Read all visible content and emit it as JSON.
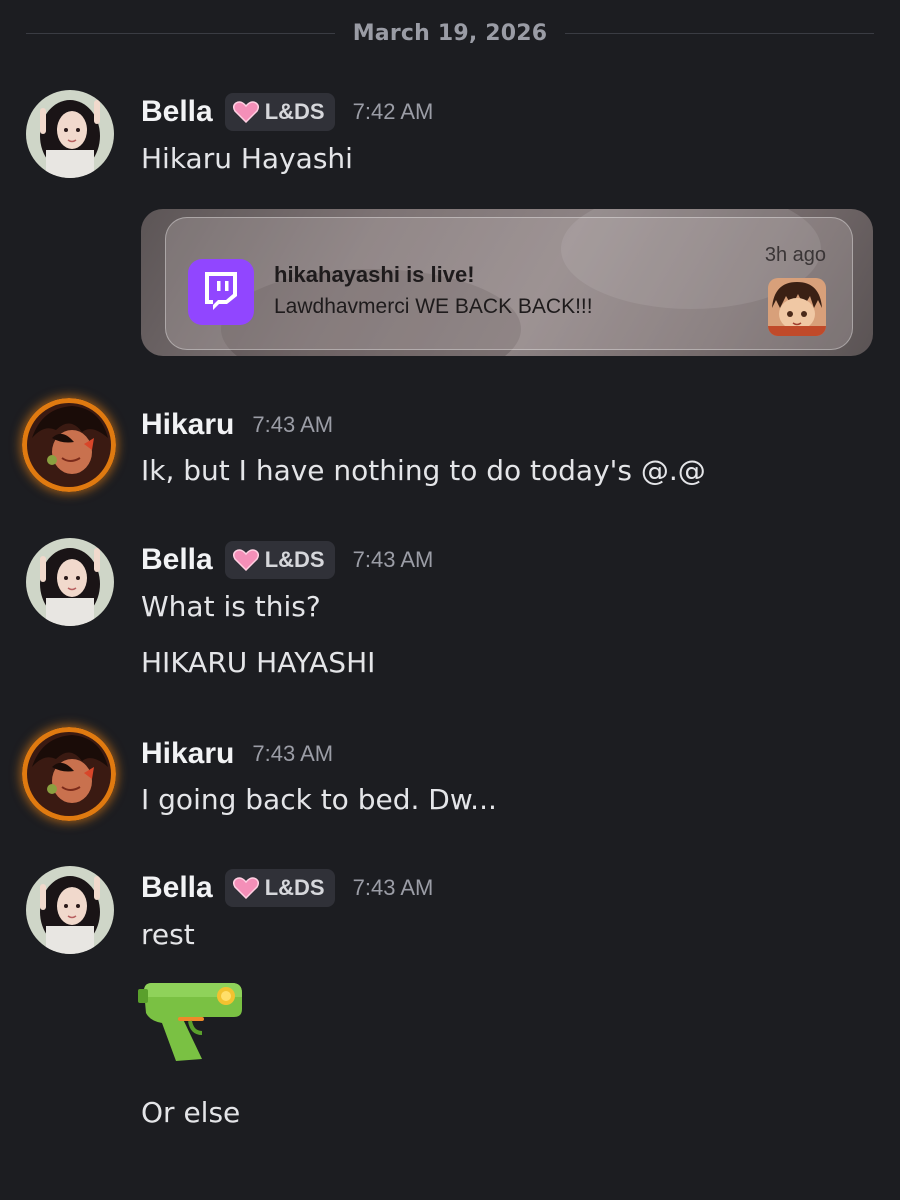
{
  "date_divider": "March 19, 2026",
  "colors": {
    "background": "#1c1d21",
    "twitch_purple": "#9146ff",
    "tag_background": "#303138"
  },
  "messages": [
    {
      "author": "Bella",
      "avatar": "bella-avatar",
      "tag": {
        "icon": "pink-heart-icon",
        "label": "L&DS"
      },
      "time": "7:42 AM",
      "lines": [
        "Hikaru Hayashi"
      ],
      "embed": {
        "type": "twitch-live-notification",
        "icon": "twitch-icon",
        "title": "hikahayashi is live!",
        "body": "Lawdhavmerci WE BACK BACK!!!",
        "time": "3h ago"
      }
    },
    {
      "author": "Hikaru",
      "avatar": "hikaru-avatar",
      "time": "7:43 AM",
      "lines": [
        "Ik, but I have nothing to do today's @.@"
      ]
    },
    {
      "author": "Bella",
      "avatar": "bella-avatar",
      "tag": {
        "icon": "pink-heart-icon",
        "label": "L&DS"
      },
      "time": "7:43 AM",
      "lines": [
        "What is this?",
        "HIKARU HAYASHI"
      ]
    },
    {
      "author": "Hikaru",
      "avatar": "hikaru-avatar",
      "time": "7:43 AM",
      "lines": [
        "I going back to bed. Dw..."
      ]
    },
    {
      "author": "Bella",
      "avatar": "bella-avatar",
      "tag": {
        "icon": "pink-heart-icon",
        "label": "L&DS"
      },
      "time": "7:43 AM",
      "lines": [
        "rest",
        "Or else"
      ],
      "emoji": "water-pistol-emoji"
    }
  ]
}
